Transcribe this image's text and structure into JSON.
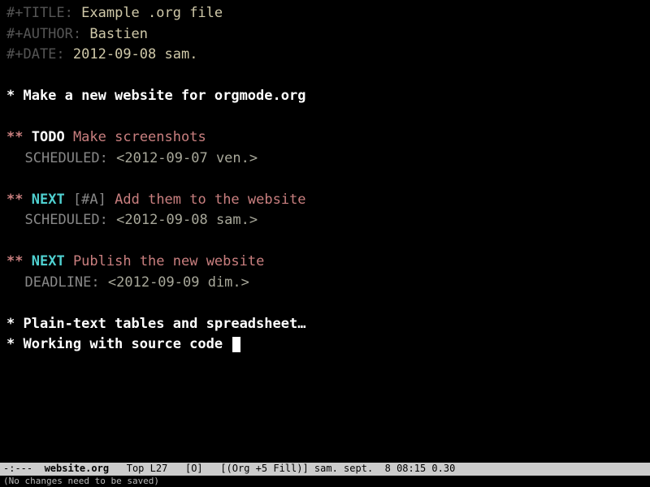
{
  "meta": {
    "title_key": "#+TITLE:",
    "title_value": "Example .org file",
    "author_key": "#+AUTHOR:",
    "author_value": "Bastien",
    "date_key": "#+DATE:",
    "date_value": "2012-09-08 sam."
  },
  "headings": {
    "h1_a": "* Make a new website for orgmode.org",
    "item1": {
      "marker": "**",
      "keyword": "TODO",
      "title": "Make screenshots",
      "sched_label": "SCHEDULED:",
      "sched_date": "<2012-09-07 ven.>"
    },
    "item2": {
      "marker": "**",
      "keyword": "NEXT",
      "priority": "[#A]",
      "title": "Add them to the website",
      "sched_label": "SCHEDULED:",
      "sched_date": "<2012-09-08 sam.>"
    },
    "item3": {
      "marker": "**",
      "keyword": "NEXT",
      "title": "Publish the new website",
      "dead_label": "DEADLINE:",
      "dead_date": "<2012-09-09 dim.>"
    },
    "h1_b": "* Plain-text tables and spreadsheet…",
    "h1_c": "* Working with source code "
  },
  "modeline": {
    "left": "-:---  ",
    "buffer": "website.org",
    "rest": "   Top L27   [O]   [(Org +5 Fill)] sam. sept.  8 08:15 0.30"
  },
  "minibuffer": "(No changes need to be saved)"
}
